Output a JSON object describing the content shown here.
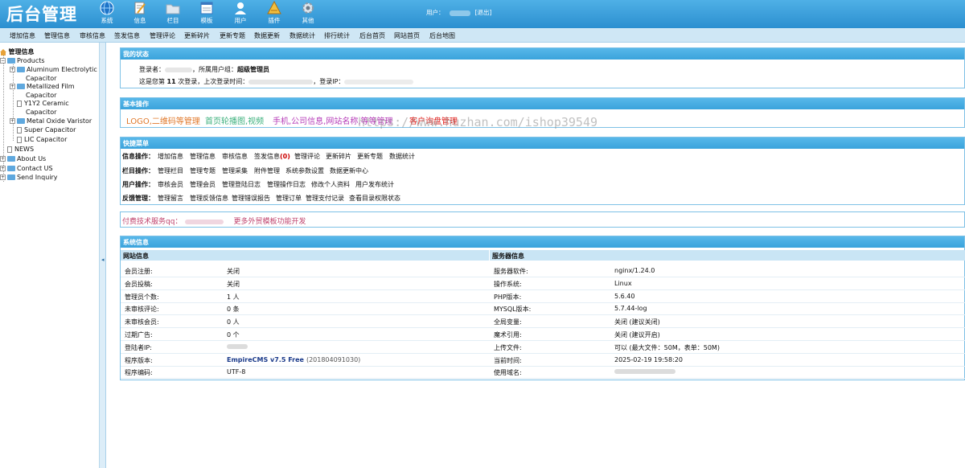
{
  "header": {
    "brand": "后台管理",
    "icons": [
      {
        "label": "系统",
        "icon": "globe-icon"
      },
      {
        "label": "信息",
        "icon": "pencil-note-icon"
      },
      {
        "label": "栏目",
        "icon": "folder-icon"
      },
      {
        "label": "模板",
        "icon": "window-icon"
      },
      {
        "label": "用户",
        "icon": "user-icon"
      },
      {
        "label": "插件",
        "icon": "plugin-icon"
      },
      {
        "label": "其他",
        "icon": "gear-icon"
      }
    ],
    "user_label": "用户：",
    "logout": "[退出]"
  },
  "menubar": [
    "增加信息",
    "管理信息",
    "审核信息",
    "签发信息",
    "管理评论",
    "更新碎片",
    "更新专题",
    "数据更新",
    "数据统计",
    "排行统计",
    "后台首页",
    "网站首页",
    "后台地图"
  ],
  "sidebar": {
    "root": "管理信息",
    "products": "Products",
    "items": [
      {
        "label": "Aluminum Electrolytic",
        "label2": "Capacitor",
        "type": "folder"
      },
      {
        "label": "Metallized Film",
        "label2": "Capacitor",
        "type": "folder"
      },
      {
        "label": "Y1Y2 Ceramic",
        "label2": "Capacitor",
        "type": "page"
      },
      {
        "label": "Metal Oxide Varistor",
        "label2": "",
        "type": "folder"
      },
      {
        "label": "Super Capacitor",
        "label2": "",
        "type": "page"
      },
      {
        "label": "LIC Capacitor",
        "label2": "",
        "type": "page"
      }
    ],
    "news": "NEWS",
    "about": "About Us",
    "contact": "Contact US",
    "inquiry": "Send Inquiry"
  },
  "status": {
    "title": "我的状态",
    "line1_prefix": "登录者：",
    "line1_mid": "，所属用户组：",
    "line1_group": "超级管理员",
    "line2_a": "这是您第",
    "line2_count": "11",
    "line2_b": "次登录，上次登录时间：",
    "line2_c": "，登录IP："
  },
  "basic": {
    "title": "基本操作",
    "links": [
      {
        "label": "LOGO,二维码等管理",
        "color": "#e0782a"
      },
      {
        "label": "首页轮播图,视频",
        "color": "#3cb07c"
      },
      {
        "label": "手机,公司信息,网站名称,等等管理",
        "color": "#b63bb8"
      },
      {
        "label": "客户询盘管理",
        "color": "#e0201c"
      }
    ],
    "watermark": "https://www.huzhan.com/ishop39549"
  },
  "quick": {
    "title": "快捷菜单",
    "rows": [
      {
        "label": "信息操作：",
        "links": [
          "增加信息",
          "管理信息",
          "审核信息",
          "签发信息",
          "管理评论",
          "更新碎片",
          "更新专题",
          "数据统计"
        ],
        "badge": "(0)"
      },
      {
        "label": "栏目操作：",
        "links": [
          "管理栏目",
          "管理专题",
          "管理采集",
          "附件管理",
          "系统参数设置",
          "数据更新中心"
        ]
      },
      {
        "label": "用户操作：",
        "links": [
          "审核会员",
          "管理会员",
          "管理登陆日志",
          "管理操作日志",
          "修改个人资料",
          "用户发布统计"
        ]
      },
      {
        "label": "反馈管理：",
        "links": [
          "管理留言",
          "管理反馈信息",
          "管理错误报告",
          "管理订单",
          "管理支付记录",
          "查看目录权限状态"
        ]
      }
    ]
  },
  "service": {
    "label": "付费技术服务qq：",
    "more": "更多外贸模板功能开发"
  },
  "sysinfo": {
    "title": "系统信息",
    "site_head": "网站信息",
    "server_head": "服务器信息",
    "site": [
      {
        "k": "会员注册:",
        "v": "关闭"
      },
      {
        "k": "会员投稿:",
        "v": "关闭"
      },
      {
        "k": "管理员个数:",
        "v": "1 人"
      },
      {
        "k": "未审核评论:",
        "v": "0 条"
      },
      {
        "k": "未审核会员:",
        "v": "0 人"
      },
      {
        "k": "过期广告:",
        "v": "0 个"
      },
      {
        "k": "登陆者IP:",
        "v": ""
      },
      {
        "k": "程序版本:",
        "v": "EmpireCMS v7.5 Free",
        "extra": "(201804091030)"
      },
      {
        "k": "程序编码:",
        "v": "UTF-8"
      }
    ],
    "server": [
      {
        "k": "服务器软件:",
        "v": "nginx/1.24.0"
      },
      {
        "k": "操作系统:",
        "v": "Linux"
      },
      {
        "k": "PHP版本:",
        "v": "5.6.40"
      },
      {
        "k": "MYSQL版本:",
        "v": "5.7.44-log"
      },
      {
        "k": "全局变量:",
        "v": "关闭 (建议关闭)"
      },
      {
        "k": "魔术引用:",
        "v": "关闭 (建议开启)"
      },
      {
        "k": "上传文件:",
        "v": "可以 (最大文件：50M，表单：50M)"
      },
      {
        "k": "当前时间:",
        "v": "2025-02-19 19:58:20"
      },
      {
        "k": "使用域名:",
        "v": ""
      }
    ]
  }
}
